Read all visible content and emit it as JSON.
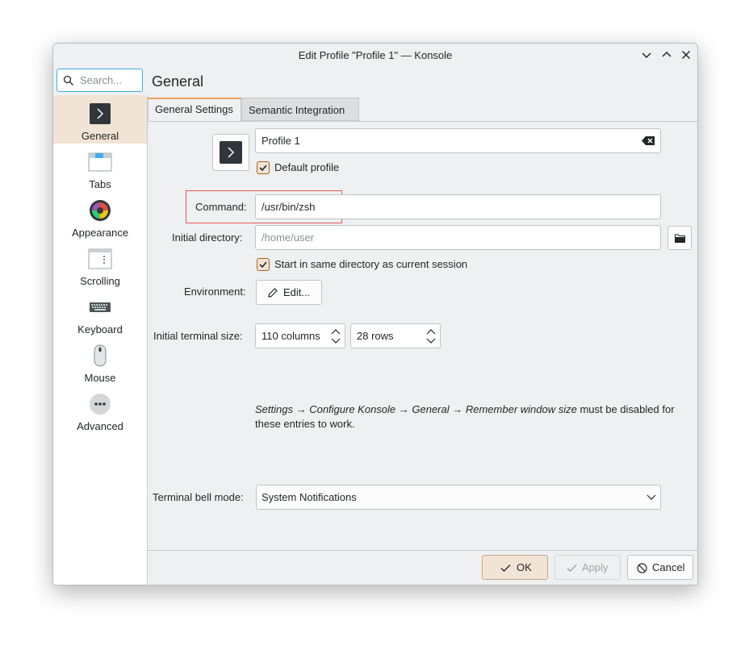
{
  "window": {
    "title": "Edit Profile \"Profile 1\" — Konsole"
  },
  "search": {
    "placeholder": "Search..."
  },
  "sidebar": {
    "items": [
      {
        "label": "General",
        "icon": "terminal-icon",
        "active": true
      },
      {
        "label": "Tabs",
        "icon": "tabs-icon"
      },
      {
        "label": "Appearance",
        "icon": "color-wheel-icon"
      },
      {
        "label": "Scrolling",
        "icon": "scrolling-icon"
      },
      {
        "label": "Keyboard",
        "icon": "keyboard-icon"
      },
      {
        "label": "Mouse",
        "icon": "mouse-icon"
      },
      {
        "label": "Advanced",
        "icon": "more-icon"
      }
    ]
  },
  "page": {
    "title": "General"
  },
  "tabs": {
    "general_settings": "General Settings",
    "semantic_integration": "Semantic Integration"
  },
  "profile": {
    "name": "Profile 1",
    "default_profile_label": "Default profile",
    "default_profile_checked": true
  },
  "command": {
    "label": "Command:",
    "value": "/usr/bin/zsh"
  },
  "initial_directory": {
    "label": "Initial directory:",
    "placeholder": "/home/user",
    "same_dir_label": "Start in same directory as current session",
    "same_dir_checked": true
  },
  "environment": {
    "label": "Environment:",
    "edit_button": "Edit..."
  },
  "terminal_size": {
    "label": "Initial terminal size:",
    "columns": "110 columns",
    "rows": "28 rows"
  },
  "note": {
    "italic": "Settings → Configure Konsole → General → Remember window size",
    "rest": " must be disabled for these entries to work."
  },
  "bell": {
    "label": "Terminal bell mode:",
    "value": "System Notifications"
  },
  "footer": {
    "ok": "OK",
    "apply": "Apply",
    "cancel": "Cancel"
  },
  "colors": {
    "accent": "#3daee9",
    "highlight": "#f2e4d5",
    "tab_accent": "#f0a050"
  }
}
